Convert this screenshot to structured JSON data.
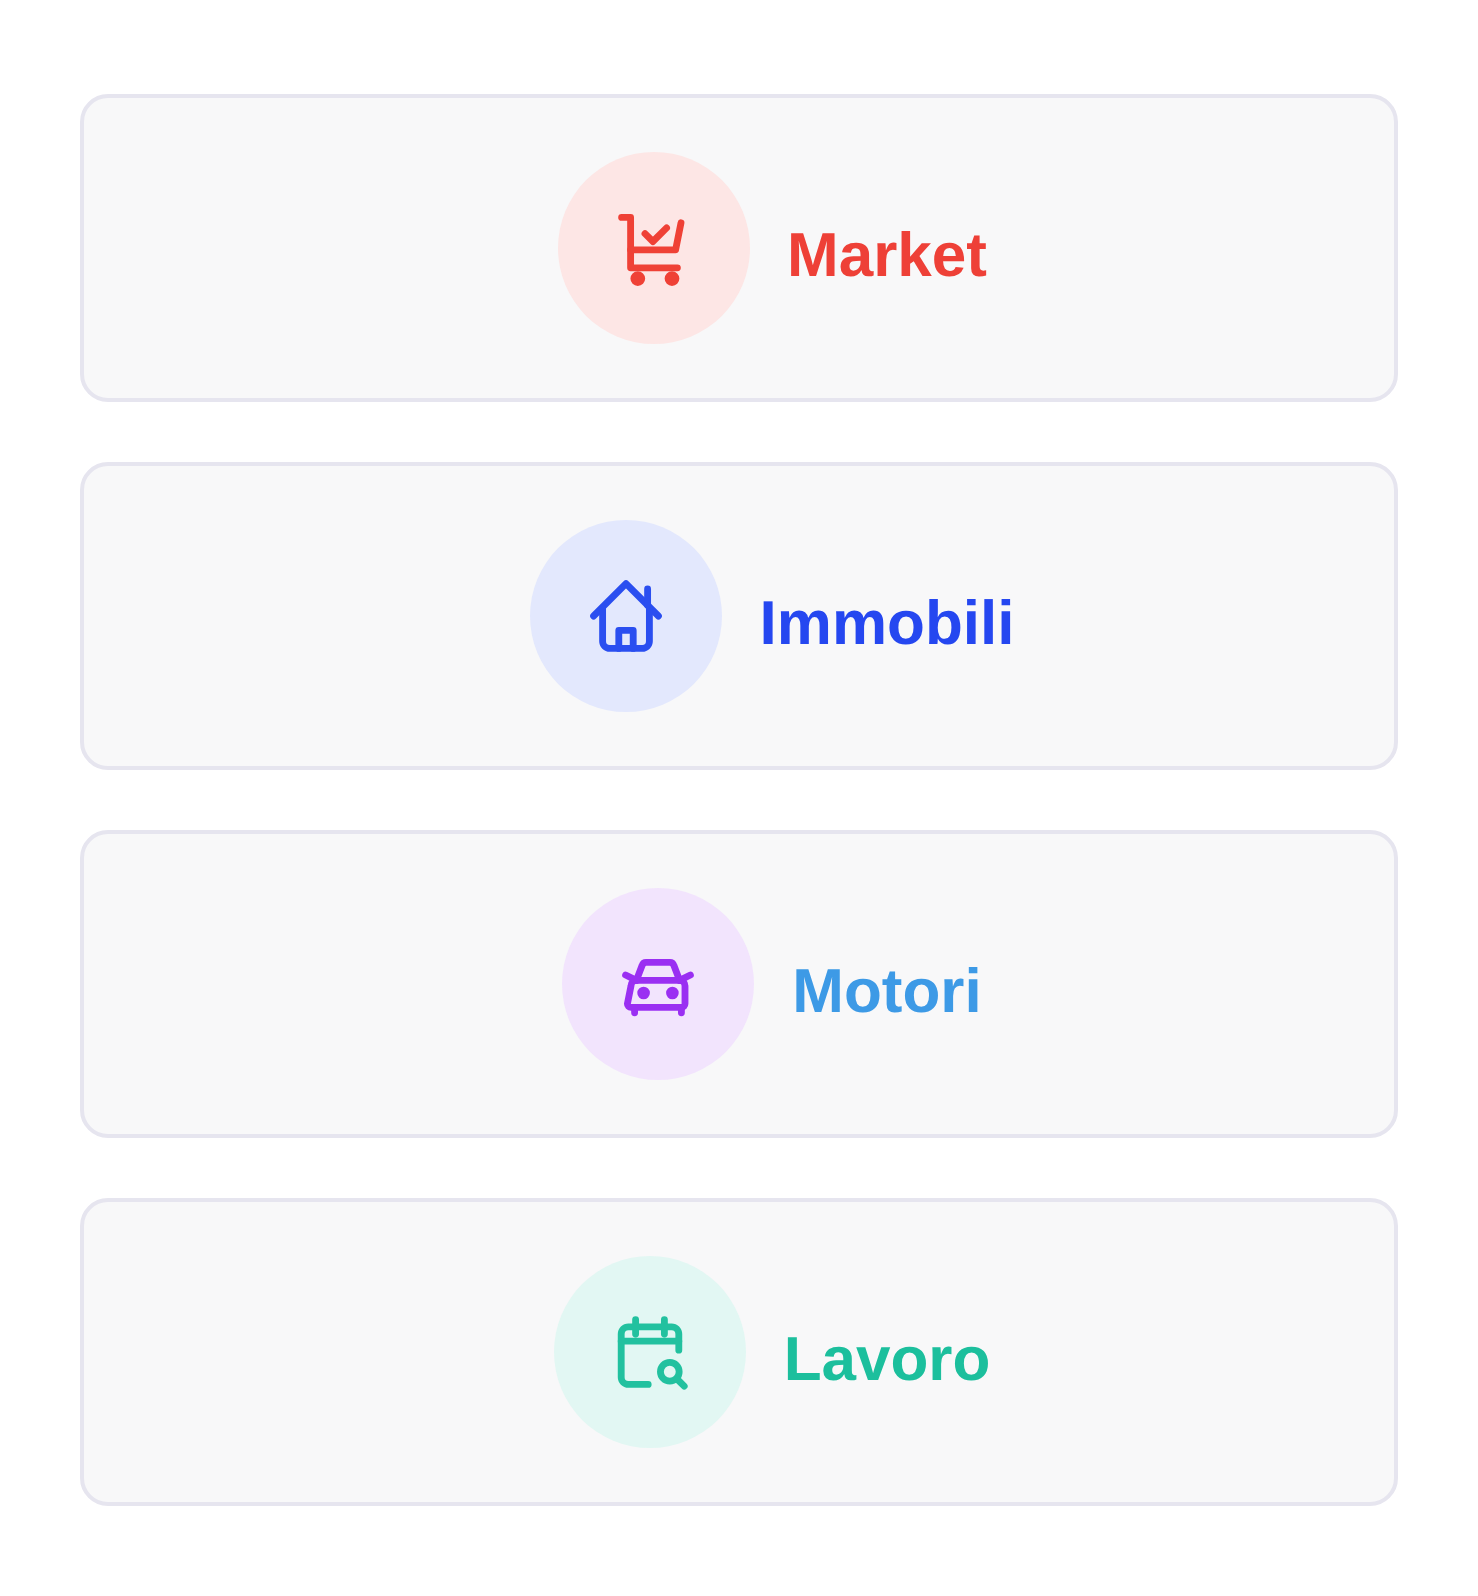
{
  "categories": [
    {
      "label": {
        "text": "Market",
        "color": "#ee4037"
      },
      "icon": {
        "kind": "cart",
        "color": "#ef4136"
      }
    },
    {
      "label": {
        "text": "Immobili",
        "color": "#2547f0"
      },
      "icon": {
        "kind": "house",
        "color": "#2a4ef0"
      }
    },
    {
      "label": {
        "text": "Motori",
        "color": "#3d9ae6"
      },
      "icon": {
        "kind": "car",
        "color": "#9a2ff2"
      }
    },
    {
      "label": {
        "text": "Lavoro",
        "color": "#1cbf9d"
      },
      "icon": {
        "kind": "calendar",
        "color": "#22c19f"
      }
    }
  ]
}
